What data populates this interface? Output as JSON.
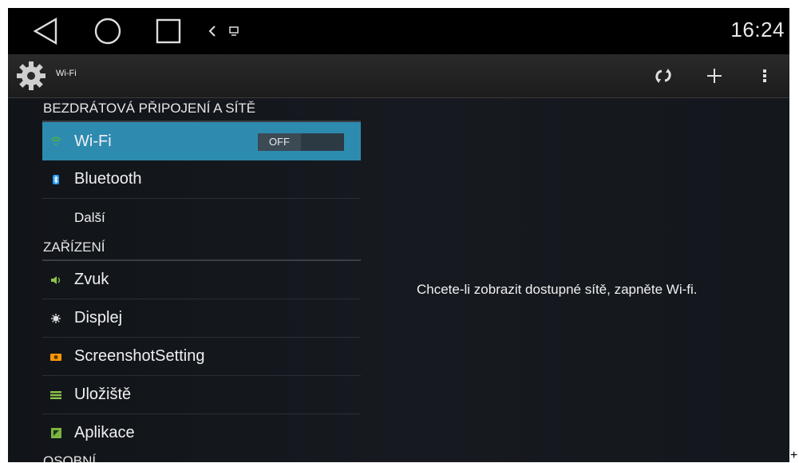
{
  "status_bar": {
    "nav_icons": [
      "back-icon",
      "home-icon",
      "recents-icon",
      "chevron-left-icon",
      "screen-cast-icon"
    ],
    "clock": "16:24"
  },
  "action_bar": {
    "title": "Wi-Fi",
    "icons": [
      "wps-icon",
      "add-icon",
      "overflow-menu-icon"
    ]
  },
  "sidebar": {
    "sections": [
      {
        "header": "BEZDRÁTOVÁ PŘIPOJENÍ A SÍTĚ",
        "items": [
          {
            "label": "Wi-Fi",
            "icon": "wifi-icon",
            "selected": true,
            "toggle": "OFF"
          },
          {
            "label": "Bluetooth",
            "icon": "bluetooth-icon"
          },
          {
            "label": "Další",
            "icon": ""
          }
        ]
      },
      {
        "header": "ZAŘÍZENÍ",
        "items": [
          {
            "label": "Zvuk",
            "icon": "speaker-icon"
          },
          {
            "label": "Displej",
            "icon": "brightness-icon"
          },
          {
            "label": "ScreenshotSetting",
            "icon": "camera-icon"
          },
          {
            "label": "Uložiště",
            "icon": "storage-icon"
          },
          {
            "label": "Aplikace",
            "icon": "apps-icon"
          }
        ]
      },
      {
        "header": "OSOBNÍ",
        "items": []
      }
    ]
  },
  "main": {
    "message": "Chcete-li zobrazit dostupné sítě, zapněte Wi-fi."
  },
  "colors": {
    "selected": "#2e8bb0",
    "wifi_icon": "#4caf50",
    "bluetooth_icon": "#2196f3",
    "speaker_icon": "#8bc34a",
    "camera_icon": "#ff9800",
    "storage_icon": "#8bc34a",
    "apps_icon": "#7cb342"
  },
  "outside_mark": "+"
}
